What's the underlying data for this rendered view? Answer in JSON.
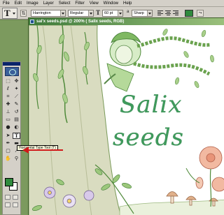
{
  "menubar": {
    "items": [
      "File",
      "Edit",
      "Image",
      "Layer",
      "Select",
      "Filter",
      "View",
      "Window",
      "Help"
    ]
  },
  "options": {
    "font_family": "Harrington",
    "font_style": "Regular",
    "font_size": "60 pt",
    "antialias_label": "a",
    "antialias_mode": "Sharp",
    "text_color": "#2f8a3d"
  },
  "document": {
    "title": "sal'x seeds.psd @ 200% ( Salix seeds, RGB)",
    "text_line1": "Salix",
    "text_line2": "seeds"
  },
  "toolbox": {
    "tooltip": "Horizontal Type Tool (T)",
    "foreground_color": "#2f8a3d",
    "background_color": "#ffffff"
  },
  "colors": {
    "text_green": "#3f9a5c",
    "arrow_red": "#d01818"
  }
}
